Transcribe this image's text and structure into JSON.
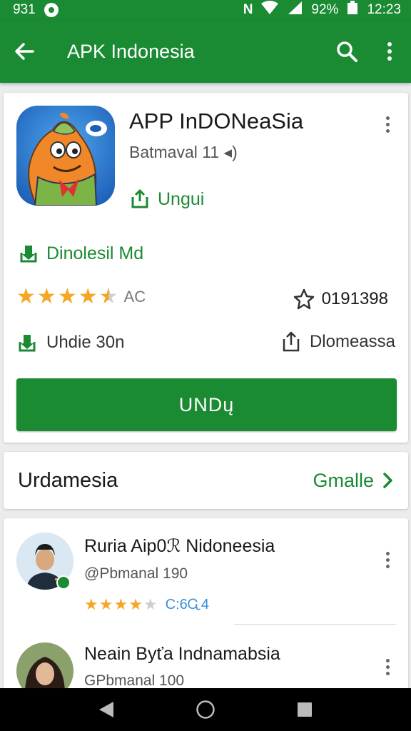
{
  "status_bar": {
    "time_left": "9̈31",
    "battery": "92%",
    "clock": "12:23"
  },
  "app_bar": {
    "title": "APK Indonesia"
  },
  "app": {
    "name": "APP InDONeaSia",
    "developer": "Batmaval  11 ◂)",
    "share_label": "Ungui",
    "download_label": "Dinolesil Md",
    "rating_count": "AC",
    "star_count": "0191398",
    "size_label": "Uhdie 30n",
    "category_label": "Dlomeassa",
    "install_label": "UNDų",
    "stars": 4.5
  },
  "section": {
    "title": "Urdamesia",
    "more_label": "Gmalle"
  },
  "list": [
    {
      "name": "Ruria Aip0ℛ Nidoneesia",
      "sub": "@Pbmanal 190",
      "rating_value": "C:6Ꮹ4",
      "stars": 4
    },
    {
      "name": "Neain Byťa  Indnamabsia",
      "sub": "GPbmanal 100"
    }
  ],
  "colors": {
    "brand": "#1a8a33",
    "star": "#f5a623"
  },
  "icons": [
    "back-arrow-icon",
    "search-icon",
    "more-vert-icon",
    "share-icon",
    "download-icon",
    "star-outline-icon",
    "chevron-right-icon",
    "nav-back-icon",
    "nav-home-icon",
    "nav-recents-icon"
  ]
}
